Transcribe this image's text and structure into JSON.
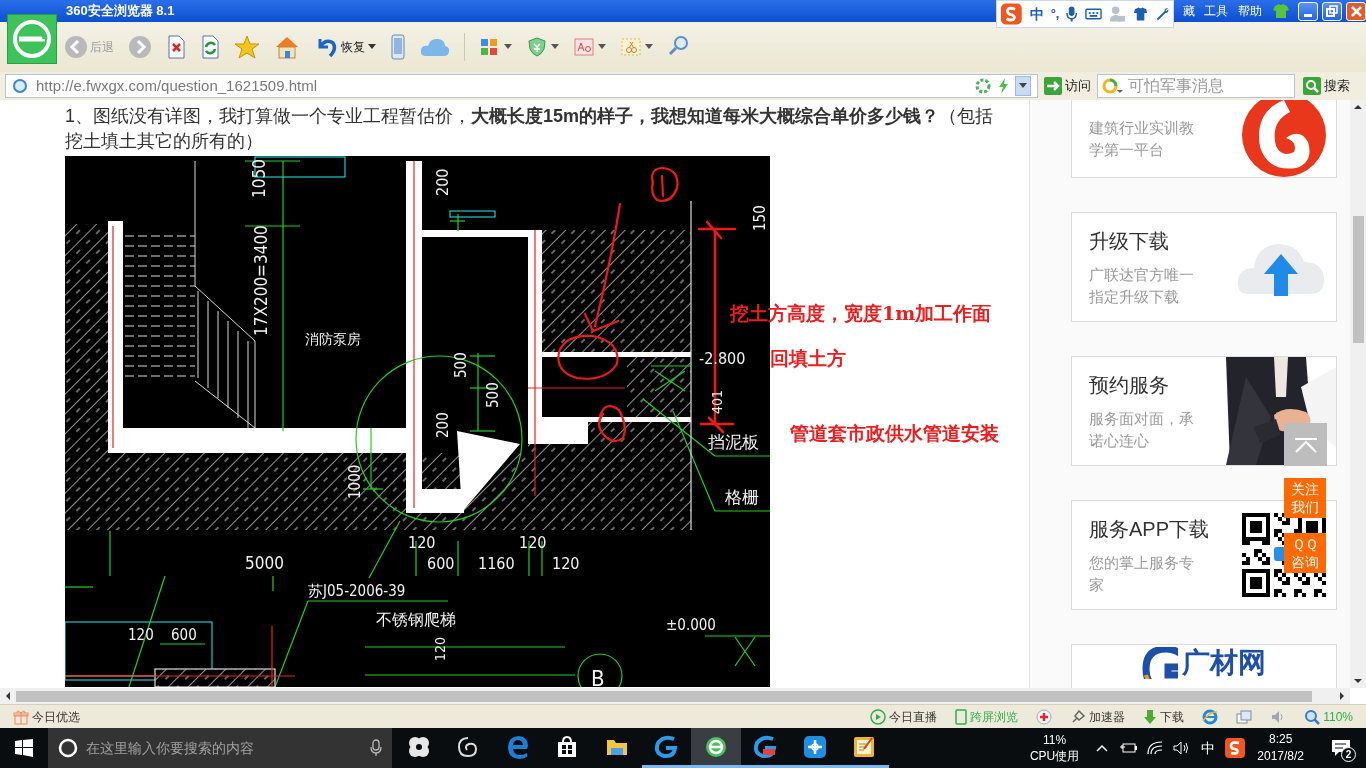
{
  "window": {
    "title": "360安全浏览器 8.1"
  },
  "menu": [
    {
      "label": "藏"
    },
    {
      "label": "工具"
    },
    {
      "label": "帮助"
    }
  ],
  "ime_toolbar": {
    "mode": "中",
    "punctuation": "°,"
  },
  "toolbar": {
    "back_label": "后退",
    "restore_label": "恢复"
  },
  "address_bar": {
    "url": "http://e.fwxgx.com/question_1621509.html",
    "visit_label": "访问",
    "search_value": "可怕军事消息",
    "search_label": "搜索"
  },
  "question": {
    "text": "1、图纸没有详图，我打算做一个专业工程暂估价，**大概长度15m的样子，我想知道每米大概综合单价多少钱？**（包括挖土填土其它的所有的）"
  },
  "drawing": {
    "labels": [
      {
        "text": "1050"
      },
      {
        "text": "17X200=3400"
      },
      {
        "text": "消防泵房"
      },
      {
        "text": "200"
      },
      {
        "text": "500"
      },
      {
        "text": "500"
      },
      {
        "text": "200"
      },
      {
        "text": "1000"
      },
      {
        "text": "-2.800"
      },
      {
        "text": "401"
      },
      {
        "text": "150"
      },
      {
        "text": "挡泥板"
      },
      {
        "text": "格栅"
      },
      {
        "text": "5000"
      },
      {
        "text": "120"
      },
      {
        "text": "600"
      },
      {
        "text": "1160"
      },
      {
        "text": "120"
      },
      {
        "text": "120"
      },
      {
        "text": "苏J05-2006-39"
      },
      {
        "text": "不锈钢爬梯"
      },
      {
        "text": "120"
      },
      {
        "text": "600"
      },
      {
        "text": "±0.000"
      },
      {
        "text": "120"
      },
      {
        "text": "B"
      }
    ],
    "annotations": [
      {
        "text": "挖土方高度，宽度1m加工作面"
      },
      {
        "text": "回填土方"
      },
      {
        "text": "管道套市政供水管道安装"
      }
    ]
  },
  "sidebar": {
    "cards": [
      {
        "kind": "training",
        "subtitle": "建筑行业实训教学第一平台"
      },
      {
        "kind": "upgrade",
        "title": "升级下载",
        "subtitle": "广联达官方唯一指定升级下载"
      },
      {
        "kind": "service",
        "title": "预约服务",
        "subtitle": "服务面对面，承诺心连心"
      },
      {
        "kind": "app",
        "title": "服务APP下载",
        "subtitle": "您的掌上服务专家"
      },
      {
        "kind": "brand",
        "brand": "广材网"
      }
    ]
  },
  "float_buttons": [
    {
      "kind": "top"
    },
    {
      "kind": "text",
      "label": "关注我们"
    },
    {
      "kind": "text",
      "label": "ＱＱ咨询"
    }
  ],
  "status_bar": {
    "left": "今日优选",
    "live": "今日直播",
    "cross_screen": "跨屏浏览",
    "accelerator": "加速器",
    "download": "下载",
    "zoom": "110%"
  },
  "taskbar": {
    "search_placeholder": "在这里输入你要搜索的内容",
    "apps": [
      {
        "kind": "fan",
        "running": false,
        "active": false
      },
      {
        "kind": "swirl",
        "running": false,
        "active": false
      },
      {
        "kind": "edge",
        "running": false,
        "active": false
      },
      {
        "kind": "store",
        "running": false,
        "active": false
      },
      {
        "kind": "folder",
        "running": false,
        "active": false
      },
      {
        "kind": "glodon",
        "running": true,
        "active": false
      },
      {
        "kind": "browser360",
        "running": true,
        "active": true
      },
      {
        "kind": "glodon-red",
        "running": true,
        "active": false
      },
      {
        "kind": "plus",
        "running": true,
        "active": false
      },
      {
        "kind": "notepad",
        "running": true,
        "active": false
      }
    ],
    "cpu": "11%",
    "cpu_label": "CPU使用",
    "ime": "中",
    "time": "8:25",
    "date": "2017/8/2",
    "notifications": "2"
  }
}
